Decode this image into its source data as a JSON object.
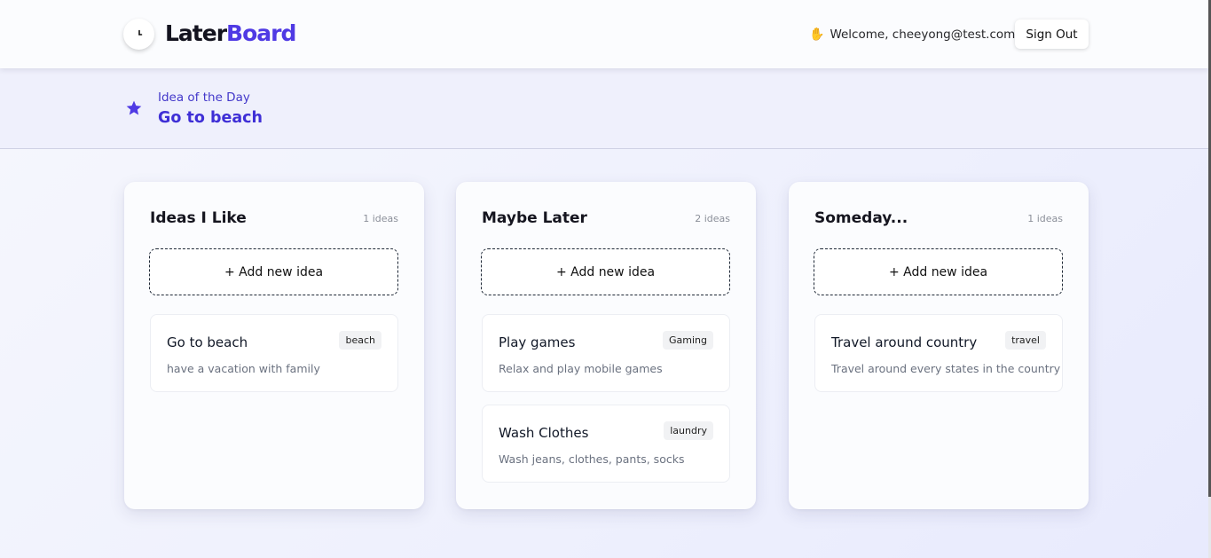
{
  "header": {
    "logo_part1": "Later",
    "logo_part2": "Board",
    "welcome_text": "Welcome, cheeyong@test.com",
    "sign_out_label": "Sign Out",
    "accent_color": "#4f3ae4"
  },
  "idea_of_the_day": {
    "label": "Idea of the Day",
    "title": "Go to beach"
  },
  "columns": [
    {
      "title": "Ideas I Like",
      "count": "1 ideas",
      "add_label": "+ Add new idea",
      "cards": [
        {
          "title": "Go to beach",
          "tag": "beach",
          "description": "have a vacation with family"
        }
      ]
    },
    {
      "title": "Maybe Later",
      "count": "2 ideas",
      "add_label": "+ Add new idea",
      "cards": [
        {
          "title": "Play games",
          "tag": "Gaming",
          "description": "Relax and play mobile games"
        },
        {
          "title": "Wash Clothes",
          "tag": "laundry",
          "description": "Wash jeans, clothes, pants, socks"
        }
      ]
    },
    {
      "title": "Someday...",
      "count": "1 ideas",
      "add_label": "+ Add new idea",
      "cards": [
        {
          "title": "Travel around country",
          "tag": "travel",
          "description": "Travel around every states in the country"
        }
      ]
    }
  ]
}
